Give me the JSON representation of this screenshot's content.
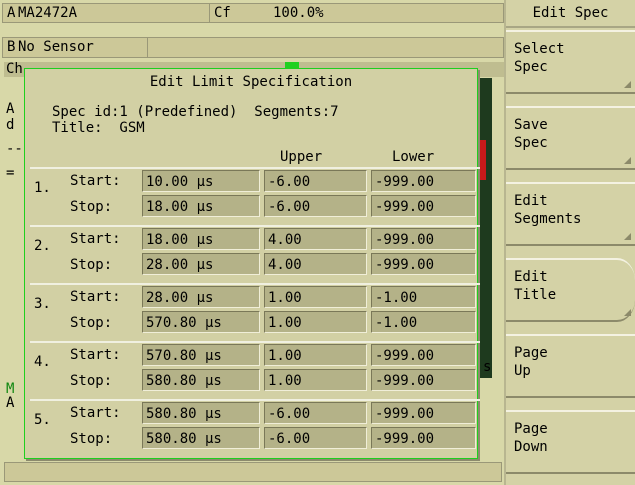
{
  "status": {
    "rowA": {
      "tag": "A",
      "sensor": "MA2472A",
      "cf_label": "Cf",
      "cf_value": "100.0%"
    },
    "rowB": {
      "tag": "B",
      "sensor": "No Sensor"
    }
  },
  "background": {
    "cha_label": "Ch",
    "line_a": "A",
    "line_d": "d",
    "dash": "--",
    "eq": "=",
    "s": "s",
    "m": "M",
    "a": "A"
  },
  "dialog": {
    "title": "Edit Limit Specification",
    "spec_line": "Spec id:1 (Predefined)  Segments:7",
    "title_line": "Title:  GSM",
    "col_upper": "Upper",
    "col_lower": "Lower",
    "start_label": "Start:",
    "stop_label": "Stop:",
    "segments": [
      {
        "num": "1.",
        "start": "10.00 µs",
        "start_upper": "-6.00",
        "start_lower": "-999.00",
        "stop": "18.00 µs",
        "stop_upper": "-6.00",
        "stop_lower": "-999.00"
      },
      {
        "num": "2.",
        "start": "18.00 µs",
        "start_upper": "4.00",
        "start_lower": "-999.00",
        "stop": "28.00 µs",
        "stop_upper": "4.00",
        "stop_lower": "-999.00"
      },
      {
        "num": "3.",
        "start": "28.00 µs",
        "start_upper": "1.00",
        "start_lower": "-1.00",
        "stop": "570.80 µs",
        "stop_upper": "1.00",
        "stop_lower": "-1.00"
      },
      {
        "num": "4.",
        "start": "570.80 µs",
        "start_upper": "1.00",
        "start_lower": "-999.00",
        "stop": "580.80 µs",
        "stop_upper": "1.00",
        "stop_lower": "-999.00"
      },
      {
        "num": "5.",
        "start": "580.80 µs",
        "start_upper": "-6.00",
        "start_lower": "-999.00",
        "stop": "580.80 µs",
        "stop_upper": "-6.00",
        "stop_lower": "-999.00"
      }
    ]
  },
  "softkeys": {
    "menu_title": "Edit Spec",
    "keys": [
      {
        "l1": "Select",
        "l2": "Spec"
      },
      {
        "l1": "Save",
        "l2": "Spec"
      },
      {
        "l1": "Edit",
        "l2": "Segments"
      },
      {
        "l1": "Edit",
        "l2": "Title"
      },
      {
        "l1": "Page",
        "l2": "Up"
      },
      {
        "l1": "Page",
        "l2": "Down"
      }
    ]
  }
}
